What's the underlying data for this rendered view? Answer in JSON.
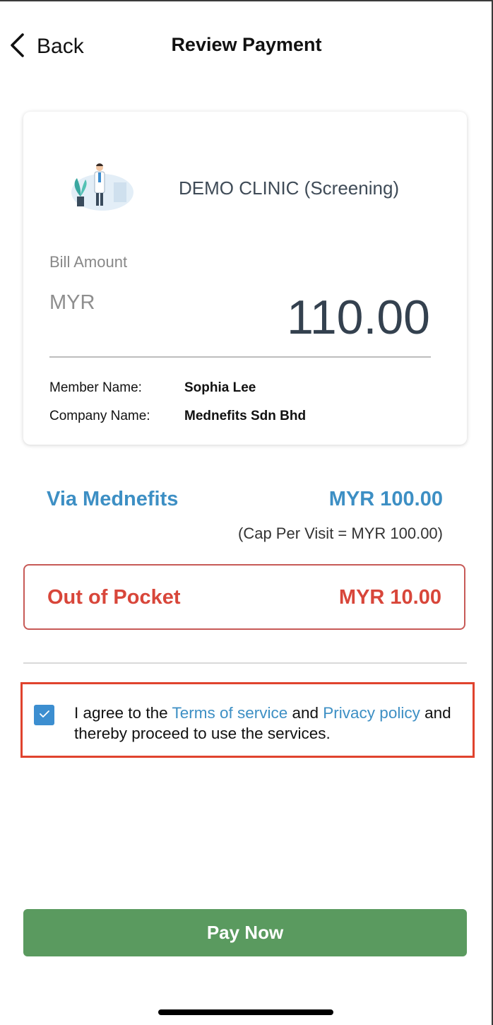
{
  "header": {
    "back_label": "Back",
    "title": "Review Payment"
  },
  "card": {
    "clinic_name": "DEMO CLINIC (Screening)",
    "bill_label": "Bill Amount",
    "currency": "MYR",
    "amount": "110.00",
    "member_label": "Member Name:",
    "member_value": "Sophia Lee",
    "company_label": "Company Name:",
    "company_value": "Mednefits Sdn Bhd"
  },
  "coverage": {
    "via_label": "Via Mednefits",
    "via_amount": "MYR 100.00",
    "cap_note": "(Cap Per Visit = MYR 100.00)",
    "oop_label": "Out of Pocket",
    "oop_amount": "MYR 10.00"
  },
  "agreement": {
    "checked": true,
    "text_1": "I agree to the ",
    "terms_link": "Terms of service",
    "text_2": " and ",
    "privacy_link": "Privacy policy",
    "text_3": " and thereby proceed to use the services."
  },
  "actions": {
    "pay_label": "Pay Now"
  },
  "colors": {
    "accent_blue": "#3d8fc4",
    "alert_red": "#d8463a",
    "pay_green": "#5a9a5f"
  }
}
